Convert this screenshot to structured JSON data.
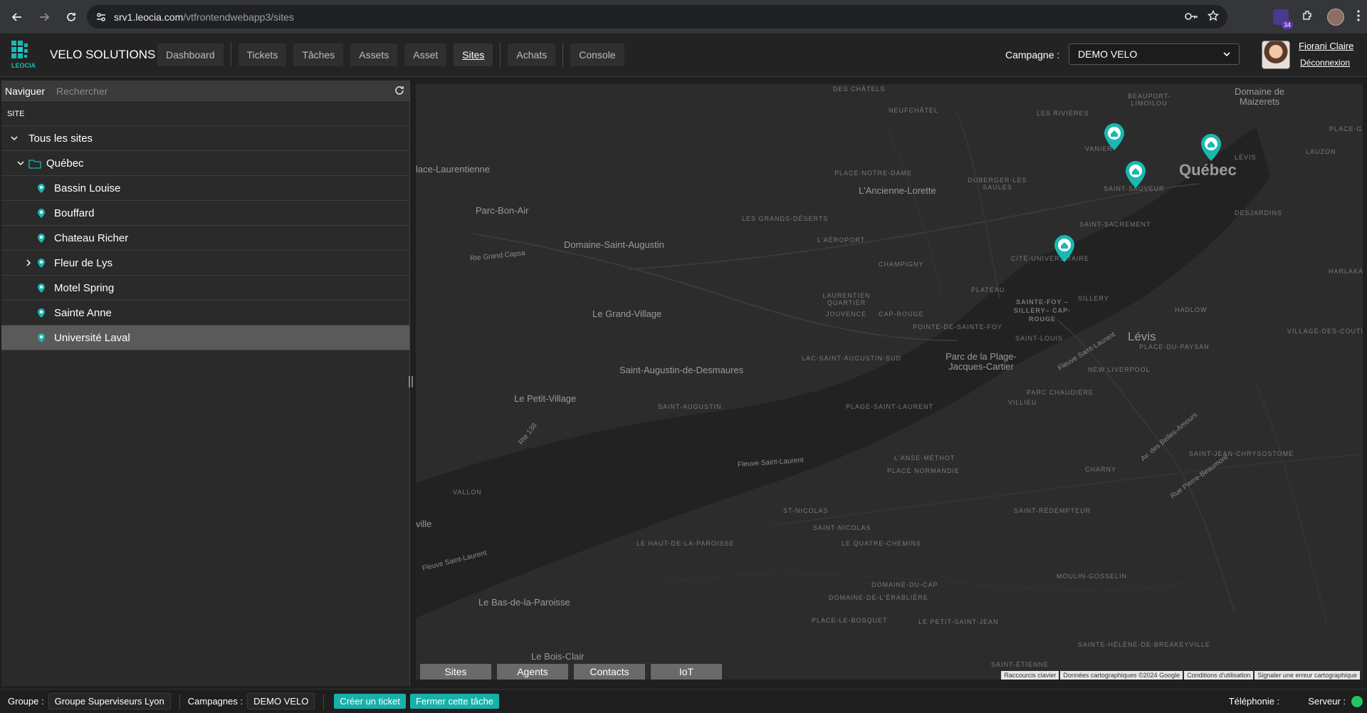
{
  "browser": {
    "url_host": "srv1.leocia.com",
    "url_path": "/vtfrontendwebapp3/sites",
    "extension_badge": "34"
  },
  "header": {
    "logo_text": "LEOCIA",
    "brand": "VELO SOLUTIONS",
    "nav": [
      {
        "label": "Dashboard"
      },
      {
        "label": "Tickets"
      },
      {
        "label": "Tâches"
      },
      {
        "label": "Assets"
      },
      {
        "label": "Asset"
      },
      {
        "label": "Sites"
      },
      {
        "label": "Achats"
      },
      {
        "label": "Console"
      }
    ],
    "active_nav": "Sites",
    "campaign_label": "Campagne :",
    "campaign_value": "DEMO VELO",
    "user_name": "Fiorani Claire",
    "logout": "Déconnexion"
  },
  "left_panel": {
    "tab_label": "Naviguer",
    "search_placeholder": "Rechercher",
    "column_header": "SITE",
    "root": "Tous les sites",
    "folder": "Québec",
    "sites": [
      {
        "label": "Bassin Louise",
        "expandable": false,
        "selected": false
      },
      {
        "label": "Bouffard",
        "expandable": false,
        "selected": false
      },
      {
        "label": "Chateau Richer",
        "expandable": false,
        "selected": false
      },
      {
        "label": "Fleur de Lys",
        "expandable": true,
        "selected": false
      },
      {
        "label": "Motel Spring",
        "expandable": false,
        "selected": false
      },
      {
        "label": "Sainte Anne",
        "expandable": false,
        "selected": false
      },
      {
        "label": "Université Laval",
        "expandable": false,
        "selected": true
      }
    ]
  },
  "map": {
    "labels": {
      "quebec": "Québec",
      "levis": "Lévis",
      "domaine_maizerets": "Domaine de Maizerets",
      "des_chatels": "DES CHÂTELS",
      "neufchatel": "NEUFCHÂTEL",
      "les_rivieres": "LES RIVIÈRES",
      "beauport": "BEAUPORT-LIMOILOU",
      "place_gare": "PLACE-G",
      "vanier": "VANIER",
      "levis_small": "LÉVIS",
      "lauzon": "LAUZON",
      "desjardins": "DESJARDINS",
      "harlaka": "HARLAKA",
      "place_notre_dame": "PLACE-NOTRE-DAME",
      "ancienne_lorette": "L'Ancienne-Lorette",
      "duberger": "DUBERGER-LES SAULES",
      "saint_sauveur": "SAINT-SAUVEUR",
      "place_laurentienne": "lace-Laurentienne",
      "parc_bon_air": "Parc-Bon-Air",
      "grands_deserts": "LES GRANDS-DÉSERTS",
      "saint_sacrement": "SAINT-SACREMENT",
      "aeroport": "L'AÉROPORT",
      "domaine_st_augustin": "Domaine-Saint-Augustin",
      "rte_grand_capsa": "Rte Grand Capsa",
      "champigny": "CHAMPIGNY",
      "cite_universitaire": "CITÉ-UNIVERSITAIRE",
      "plateau": "PLATEAU",
      "laurentien": "LAURENTIEN QUARTIER",
      "jouvence": "JOUVENCE",
      "cap_rouge": "CAP-ROUGE",
      "sainte_foy": "SAINTE-FOY –SILLERY– CAP-ROUGE",
      "sillery": "SILLERY",
      "grand_village": "Le Grand-Village",
      "hadlow": "HADLOW",
      "pointe_ste_foy": "POINTE-DE-SAINTE-FOY",
      "saint_louis": "SAINT-LOUIS",
      "place_du_paysan": "PLACE-DU-PAYSAN",
      "village_des_coutu": "VILLAGE-DES-COUTU",
      "lac_st_augustin_sud": "LAC-SAINT-AUGUSTIN-SUD",
      "parc_plage": "Parc de la Plage-Jacques-Cartier",
      "fleuve_st_laurent_1": "Fleuve Saint-Laurent",
      "new_liverpool": "NEW LIVERPOOL",
      "st_augustin_desmaures": "Saint-Augustin-de-Desmaures",
      "petit_village": "Le Petit-Village",
      "parc_chaudiere": "PARC CHAUDIÈRE",
      "villieu": "VILLIEU",
      "saint_augustin": "SAINT-AUGUSTIN",
      "plage_st_laurent": "PLAGE-SAINT-LAURENT",
      "rte_138": "Rte 138",
      "av_etchemins": "Av. des Belles-Amours",
      "st_jean_chrysostome": "SAINT-JEAN-CHRYSOSTOME",
      "fleuve_st_laurent_2": "Fleuve Saint-Laurent",
      "anse_methot": "L'ANSE-MÉTHOT",
      "charny": "CHARNY",
      "place_normandie": "PLACE NORMANDIE",
      "vallon": "VALLON",
      "rue_pierre": "Rue Pierre-Beaumont",
      "ville": "ville",
      "st_nicolas": "ST-NICOLAS",
      "saint_redempteur": "SAINT-RÉDEMPTEUR",
      "saint_nicolas": "SAINT-NICOLAS",
      "haut_paroisse": "LE HAUT-DE-LA-PAROISSE",
      "quatre_chemins": "LE QUATRE-CHEMINS",
      "fleuve_st_laurent_3": "Fleuve Saint-Laurent",
      "moulin_gosselin": "MOULIN-GOSSELIN",
      "domaine_du_cap": "DOMAINE-DU-CAP",
      "bas_paroisse": "Le Bas-de-la-Paroisse",
      "domaine_erabliere": "DOMAINE-DE-L'ÉRABLIÈRE",
      "place_bosquet": "PLACE-LE-BOSQUET",
      "petit_saint_jean": "LE PETIT-SAINT-JEAN",
      "sainte_helene": "SAINTE-HÉLÈNE-DE-BREAKEYVILLE",
      "bois_clair": "Le Bois-Clair",
      "saint_etienne": "SAINT-ÉTIENNE"
    },
    "tabs": [
      "Sites",
      "Agents",
      "Contacts",
      "IoT"
    ],
    "attribution": [
      "Raccourcis clavier",
      "Données cartographiques ©2024 Google",
      "Conditions d'utilisation",
      "Signaler une erreur cartographique"
    ],
    "pin_color": "#19b8b0"
  },
  "status_bar": {
    "groupe_label": "Groupe :",
    "groupe_value": "Groupe Superviseurs Lyon",
    "campagnes_label": "Campagnes :",
    "campagnes_value": "DEMO VELO",
    "create_ticket": "Créer un ticket",
    "close_task": "Fermer cette tâche",
    "telephonie_label": "Téléphonie :",
    "serveur_label": "Serveur :",
    "server_status_color": "#22c55e"
  }
}
